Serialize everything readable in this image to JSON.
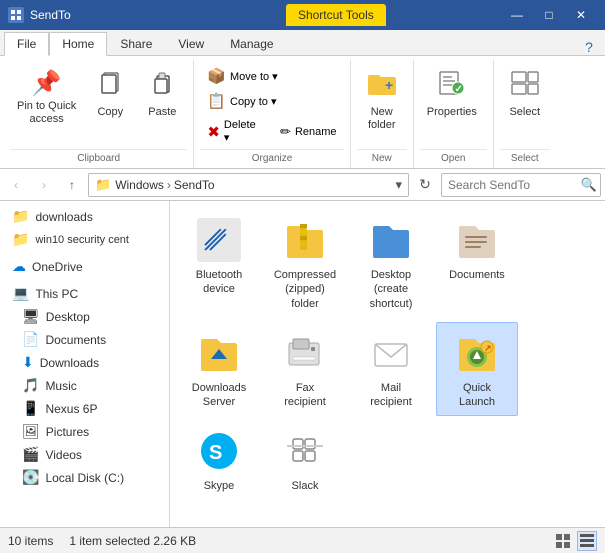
{
  "titleBar": {
    "appName": "SendTo",
    "controls": [
      "—",
      "□",
      "✕"
    ],
    "shortcutToolsTab": "Shortcut Tools"
  },
  "ribbonTabs": [
    {
      "label": "File",
      "active": false
    },
    {
      "label": "Home",
      "active": true
    },
    {
      "label": "Share",
      "active": false
    },
    {
      "label": "View",
      "active": false
    },
    {
      "label": "Manage",
      "active": false
    }
  ],
  "ribbon": {
    "groups": [
      {
        "label": "Clipboard",
        "buttons": [
          {
            "type": "large",
            "icon": "📌",
            "label": "Pin to Quick\naccess"
          },
          {
            "type": "large",
            "icon": "📋",
            "label": "Copy"
          },
          {
            "type": "large",
            "icon": "📄",
            "label": "Paste"
          }
        ],
        "smallButtons": []
      },
      {
        "label": "Organize",
        "buttons": [],
        "smallButtons": [
          {
            "icon": "📦",
            "label": "Move to ▾"
          },
          {
            "icon": "📋",
            "label": "Copy to ▾"
          },
          {
            "icon": "✂",
            "label": ""
          },
          {
            "icon": "❌",
            "label": "Delete ▾"
          },
          {
            "icon": "✏",
            "label": "Rename"
          }
        ]
      },
      {
        "label": "New",
        "buttons": [
          {
            "type": "large",
            "icon": "📁",
            "label": "New\nfolder"
          }
        ]
      },
      {
        "label": "Open",
        "buttons": [
          {
            "type": "large",
            "icon": "⚙",
            "label": "Properties"
          }
        ]
      },
      {
        "label": "Select",
        "buttons": [
          {
            "type": "large",
            "icon": "☑",
            "label": "Select"
          }
        ]
      }
    ]
  },
  "addressBar": {
    "backDisabled": true,
    "forwardDisabled": true,
    "upLabel": "↑",
    "pathParts": [
      "Windows",
      "SendTo"
    ],
    "searchPlaceholder": "Search SendTo"
  },
  "sidebar": {
    "items": [
      {
        "icon": "📁",
        "label": "downloads",
        "indent": false
      },
      {
        "icon": "📁",
        "label": "win10 security cent",
        "indent": false
      },
      {
        "icon": "☁",
        "label": "OneDrive",
        "indent": false
      },
      {
        "icon": "💻",
        "label": "This PC",
        "indent": false
      },
      {
        "icon": "🖥",
        "label": "Desktop",
        "indent": true
      },
      {
        "icon": "📄",
        "label": "Documents",
        "indent": true
      },
      {
        "icon": "⬇",
        "label": "Downloads",
        "indent": true
      },
      {
        "icon": "🎵",
        "label": "Music",
        "indent": true
      },
      {
        "icon": "📱",
        "label": "Nexus 6P",
        "indent": true
      },
      {
        "icon": "🖼",
        "label": "Pictures",
        "indent": true
      },
      {
        "icon": "🎬",
        "label": "Videos",
        "indent": true
      },
      {
        "icon": "💽",
        "label": "Local Disk (C:)",
        "indent": true
      }
    ]
  },
  "fileItems": [
    {
      "id": "bluetooth",
      "label": "Bluetooth\ndevice",
      "iconType": "bluetooth",
      "selected": false
    },
    {
      "id": "compressed",
      "label": "Compressed\n(zipped)\nfolder",
      "iconType": "zip-folder",
      "selected": false
    },
    {
      "id": "desktop",
      "label": "Desktop\n(create\nshortcut)",
      "iconType": "desktop-folder",
      "selected": false
    },
    {
      "id": "documents",
      "label": "Documents",
      "iconType": "documents",
      "selected": false
    },
    {
      "id": "downloads-server",
      "label": "Downloads\nServer",
      "iconType": "downloads-folder",
      "selected": false
    },
    {
      "id": "fax",
      "label": "Fax\nrecipient",
      "iconType": "fax",
      "selected": false
    },
    {
      "id": "mail",
      "label": "Mail\nrecipient",
      "iconType": "mail",
      "selected": false
    },
    {
      "id": "quick-launch",
      "label": "Quick\nLaunch",
      "iconType": "quick-launch",
      "selected": true
    },
    {
      "id": "skype",
      "label": "Skype",
      "iconType": "skype",
      "selected": false
    },
    {
      "id": "slack",
      "label": "Slack",
      "iconType": "slack",
      "selected": false
    }
  ],
  "statusBar": {
    "itemCount": "10 items",
    "selectedInfo": "1 item selected  2.26 KB"
  }
}
